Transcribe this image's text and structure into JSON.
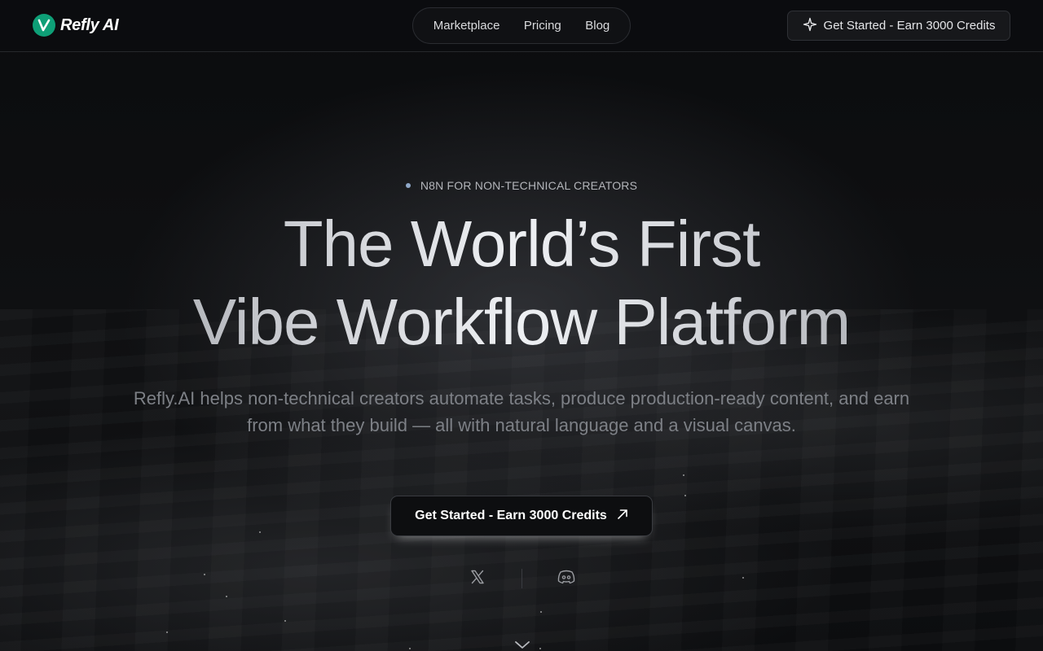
{
  "brand": {
    "name": "Refly AI",
    "accent": "#0e9f77"
  },
  "nav": {
    "links": [
      {
        "label": "Marketplace"
      },
      {
        "label": "Pricing"
      },
      {
        "label": "Blog"
      }
    ],
    "cta_label": "Get Started - Earn 3000 Credits",
    "cta_icon": "sparkle-icon"
  },
  "hero": {
    "eyebrow": "N8N FOR NON-TECHNICAL CREATORS",
    "headline_line1": "The World’s First",
    "headline_line2": "Vibe Workflow Platform",
    "subtitle": "Refly.AI helps non-technical creators automate tasks, produce production-ready content, and earn from what they build — all with natural language and a visual canvas.",
    "cta_label": "Get Started - Earn 3000 Credits",
    "cta_icon": "arrow-up-right-icon"
  },
  "social": {
    "icons": [
      "x-icon",
      "discord-icon"
    ]
  },
  "scroll_icon": "chevron-down-icon"
}
